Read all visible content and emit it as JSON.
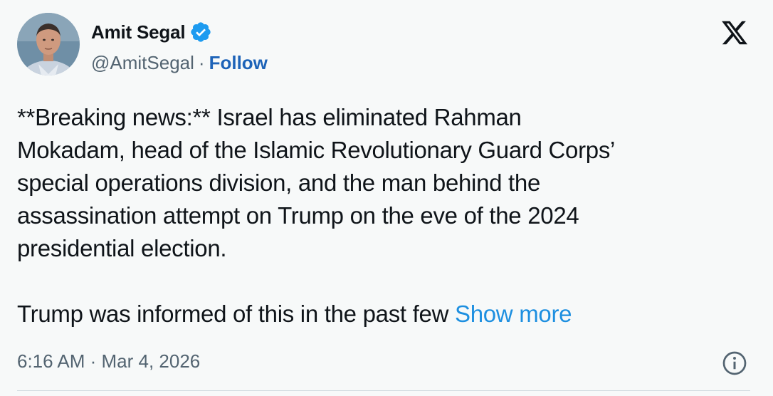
{
  "author": {
    "display_name": "Amit Segal",
    "handle": "@AmitSegal",
    "separator": "·",
    "follow_label": "Follow",
    "verified": true,
    "avatar_icon": "person-avatar-icon"
  },
  "brand": {
    "logo_icon": "x-logo-icon"
  },
  "tweet": {
    "lines": [
      "**Breaking news:** Israel has eliminated Rahman",
      "Mokadam, head of the Islamic Revolutionary Guard Corps’",
      "special operations division, and the man behind the",
      "assassination attempt on Trump on the eve of the 2024",
      "presidential election."
    ],
    "truncated_text": "Trump was informed of this in the past few ",
    "show_more_label": "Show more"
  },
  "meta": {
    "timestamp": "6:16 AM · Mar 4, 2026",
    "info_icon": "info-icon"
  },
  "colors": {
    "background": "#f7f9f9",
    "text": "#0f1419",
    "secondary": "#536471",
    "link": "#1d8fe0",
    "follow": "#1d63b8",
    "verified": "#1d9bf0"
  }
}
